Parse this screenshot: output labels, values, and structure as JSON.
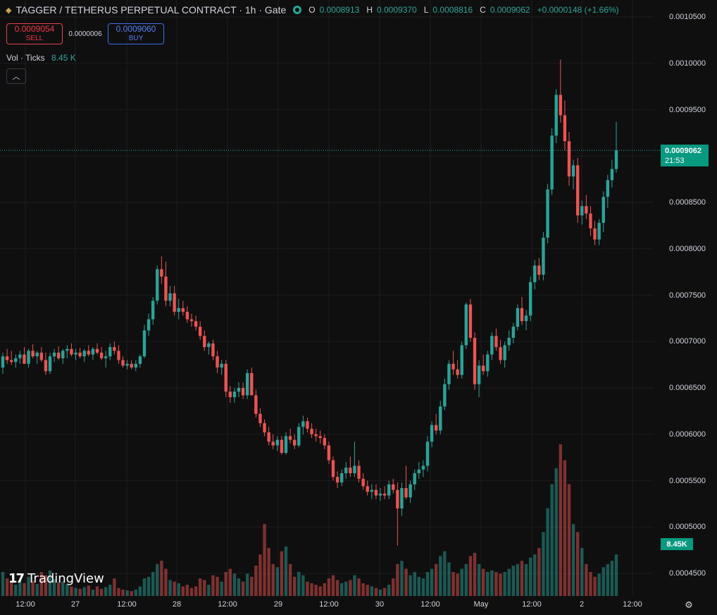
{
  "header": {
    "symbol_icon": "diamond-icon",
    "title": "TAGGER / TETHERUS PERPETUAL CONTRACT · 1h · Gate",
    "ohlc": {
      "o_label": "O",
      "o": "0.0008913",
      "h_label": "H",
      "h": "0.0009370",
      "l_label": "L",
      "l": "0.0008816",
      "c_label": "C",
      "c": "0.0009062",
      "change": "+0.0000148 (+1.66%)"
    }
  },
  "trade": {
    "sell_price": "0.0009054",
    "sell_label": "SELL",
    "spread": "0.0000006",
    "buy_price": "0.0009060",
    "buy_label": "BUY"
  },
  "volume_indicator": {
    "label": "Vol · Ticks",
    "value": "8.45 K"
  },
  "price_tag": {
    "price": "0.0009062",
    "countdown": "21:53"
  },
  "volume_tag": "8.45K",
  "logo_text": "TradingView",
  "colors": {
    "up": "#26a69a",
    "down": "#ef5350",
    "background": "#0f0f0f"
  },
  "chart_data": {
    "type": "candlestick",
    "symbol": "TAGGER / TETHERUS PERPETUAL CONTRACT",
    "interval": "1h",
    "exchange": "Gate",
    "y_ticks": [
      "0.0010500",
      "0.0010000",
      "0.0009500",
      "0.0009000",
      "0.0008500",
      "0.0008000",
      "0.0007500",
      "0.0007000",
      "0.0006500",
      "0.0006000",
      "0.0005500",
      "0.0005000",
      "0.0004500"
    ],
    "ylim": [
      0.00043,
      0.00107
    ],
    "x_ticks": [
      "12:00",
      "27",
      "12:00",
      "28",
      "12:00",
      "29",
      "12:00",
      "30",
      "12:00",
      "May",
      "12:00",
      "2",
      "12:00"
    ],
    "last_price": 0.0009062,
    "candles": [
      [
        0.000672,
        0.000688,
        0.000665,
        0.000684,
        30
      ],
      [
        0.000684,
        0.000692,
        0.000676,
        0.00068,
        22
      ],
      [
        0.00068,
        0.00069,
        0.000675,
        0.000678,
        18
      ],
      [
        0.000678,
        0.000686,
        0.000672,
        0.000682,
        14
      ],
      [
        0.000682,
        0.00069,
        0.000676,
        0.000686,
        20
      ],
      [
        0.000686,
        0.000694,
        0.00068,
        0.000676,
        16
      ],
      [
        0.000676,
        0.000692,
        0.000672,
        0.00069,
        24
      ],
      [
        0.00069,
        0.000697,
        0.000682,
        0.000684,
        19
      ],
      [
        0.000684,
        0.00069,
        0.000676,
        0.000688,
        15
      ],
      [
        0.000688,
        0.000694,
        0.000678,
        0.00068,
        30
      ],
      [
        0.00068,
        0.000688,
        0.000664,
        0.000668,
        26
      ],
      [
        0.000668,
        0.000688,
        0.000665,
        0.000684,
        32
      ],
      [
        0.000684,
        0.000692,
        0.000678,
        0.000688,
        21
      ],
      [
        0.000688,
        0.000695,
        0.00068,
        0.000682,
        17
      ],
      [
        0.000682,
        0.000692,
        0.000676,
        0.00069,
        18
      ],
      [
        0.00069,
        0.000696,
        0.000682,
        0.000692,
        15
      ],
      [
        0.000692,
        0.000698,
        0.000684,
        0.000686,
        12
      ],
      [
        0.000686,
        0.000692,
        0.00068,
        0.000688,
        10
      ],
      [
        0.000688,
        0.000693,
        0.000682,
        0.000684,
        9
      ],
      [
        0.000684,
        0.000692,
        0.000678,
        0.00069,
        11
      ],
      [
        0.00069,
        0.000696,
        0.000684,
        0.000686,
        13
      ],
      [
        0.000686,
        0.000694,
        0.00068,
        0.000692,
        8
      ],
      [
        0.000692,
        0.000698,
        0.000686,
        0.000688,
        12
      ],
      [
        0.000688,
        0.000694,
        0.00068,
        0.000682,
        9
      ],
      [
        0.000682,
        0.00069,
        0.000672,
        0.000684,
        11
      ],
      [
        0.000684,
        0.000698,
        0.00068,
        0.000694,
        14
      ],
      [
        0.000694,
        0.0007,
        0.000686,
        0.00069,
        22
      ],
      [
        0.00069,
        0.000696,
        0.000676,
        0.00068,
        10
      ],
      [
        0.00068,
        0.000684,
        0.000672,
        0.000674,
        8
      ],
      [
        0.000674,
        0.00068,
        0.00067,
        0.000676,
        7
      ],
      [
        0.000676,
        0.00068,
        0.00067,
        0.000672,
        6
      ],
      [
        0.000672,
        0.00068,
        0.000668,
        0.000676,
        8
      ],
      [
        0.000676,
        0.000686,
        0.000672,
        0.000684,
        12
      ],
      [
        0.000684,
        0.000718,
        0.000682,
        0.000712,
        22
      ],
      [
        0.000712,
        0.00073,
        0.000706,
        0.000724,
        24
      ],
      [
        0.000724,
        0.000748,
        0.000718,
        0.000744,
        30
      ],
      [
        0.000744,
        0.000782,
        0.00074,
        0.000778,
        40
      ],
      [
        0.000778,
        0.000792,
        0.000762,
        0.00077,
        44
      ],
      [
        0.00077,
        0.000786,
        0.000738,
        0.000744,
        34
      ],
      [
        0.000744,
        0.00076,
        0.000738,
        0.000752,
        20
      ],
      [
        0.000752,
        0.00076,
        0.000728,
        0.000732,
        18
      ],
      [
        0.000732,
        0.000746,
        0.000724,
        0.000736,
        16
      ],
      [
        0.000736,
        0.000744,
        0.000728,
        0.000732,
        12
      ],
      [
        0.000732,
        0.000738,
        0.00072,
        0.000724,
        14
      ],
      [
        0.000724,
        0.00073,
        0.000716,
        0.000722,
        10
      ],
      [
        0.000722,
        0.000728,
        0.000712,
        0.000716,
        12
      ],
      [
        0.000716,
        0.000722,
        0.000702,
        0.000706,
        22
      ],
      [
        0.000706,
        0.000712,
        0.00069,
        0.000694,
        20
      ],
      [
        0.000694,
        0.0007,
        0.000686,
        0.000698,
        14
      ],
      [
        0.000698,
        0.000702,
        0.00068,
        0.000684,
        26
      ],
      [
        0.000684,
        0.00069,
        0.000666,
        0.000672,
        24
      ],
      [
        0.000672,
        0.00068,
        0.000664,
        0.000676,
        18
      ],
      [
        0.000676,
        0.00068,
        0.00064,
        0.000646,
        30
      ],
      [
        0.000646,
        0.000652,
        0.000634,
        0.00064,
        34
      ],
      [
        0.00064,
        0.00065,
        0.000634,
        0.000646,
        28
      ],
      [
        0.000646,
        0.000656,
        0.00064,
        0.00065,
        22
      ],
      [
        0.00065,
        0.000656,
        0.000638,
        0.000642,
        18
      ],
      [
        0.000642,
        0.00067,
        0.000638,
        0.000666,
        28
      ],
      [
        0.000666,
        0.000672,
        0.00065,
        0.000642,
        24
      ],
      [
        0.000642,
        0.000648,
        0.000618,
        0.000622,
        38
      ],
      [
        0.000622,
        0.000628,
        0.000608,
        0.000612,
        52
      ],
      [
        0.000612,
        0.000616,
        0.000598,
        0.000602,
        90
      ],
      [
        0.000602,
        0.000608,
        0.000588,
        0.000592,
        60
      ],
      [
        0.000592,
        0.0006,
        0.000584,
        0.000588,
        40
      ],
      [
        0.000588,
        0.000598,
        0.000582,
        0.000594,
        36
      ],
      [
        0.000594,
        0.000598,
        0.000578,
        0.00058,
        56
      ],
      [
        0.00058,
        0.000602,
        0.000578,
        0.000598,
        62
      ],
      [
        0.000598,
        0.000606,
        0.00059,
        0.000594,
        40
      ],
      [
        0.000594,
        0.0006,
        0.000584,
        0.000588,
        24
      ],
      [
        0.000588,
        0.000612,
        0.000586,
        0.000608,
        30
      ],
      [
        0.000608,
        0.00062,
        0.0006,
        0.000614,
        26
      ],
      [
        0.000614,
        0.000618,
        0.000602,
        0.000606,
        18
      ],
      [
        0.000606,
        0.000612,
        0.000596,
        0.0006,
        16
      ],
      [
        0.0006,
        0.000606,
        0.000592,
        0.000598,
        14
      ],
      [
        0.000598,
        0.000604,
        0.00059,
        0.000596,
        12
      ],
      [
        0.000596,
        0.0006,
        0.000584,
        0.000588,
        16
      ],
      [
        0.000588,
        0.000592,
        0.000568,
        0.000572,
        22
      ],
      [
        0.000572,
        0.000576,
        0.00055,
        0.000554,
        26
      ],
      [
        0.000554,
        0.00056,
        0.000542,
        0.000548,
        20
      ],
      [
        0.000548,
        0.000562,
        0.000544,
        0.000558,
        16
      ],
      [
        0.000558,
        0.00057,
        0.000552,
        0.000564,
        18
      ],
      [
        0.000564,
        0.000576,
        0.000554,
        0.000558,
        20
      ],
      [
        0.000558,
        0.000592,
        0.000554,
        0.000566,
        26
      ],
      [
        0.000566,
        0.000572,
        0.000548,
        0.000552,
        22
      ],
      [
        0.000552,
        0.000558,
        0.00054,
        0.000544,
        16
      ],
      [
        0.000544,
        0.00055,
        0.000534,
        0.000538,
        14
      ],
      [
        0.000538,
        0.000546,
        0.00053,
        0.00054,
        12
      ],
      [
        0.00054,
        0.000546,
        0.00053,
        0.000534,
        10
      ],
      [
        0.000534,
        0.000542,
        0.000528,
        0.000536,
        8
      ],
      [
        0.000536,
        0.000544,
        0.00053,
        0.000534,
        10
      ],
      [
        0.000534,
        0.00055,
        0.00053,
        0.000546,
        14
      ],
      [
        0.000546,
        0.000552,
        0.000536,
        0.00054,
        22
      ],
      [
        0.00054,
        0.000548,
        0.00048,
        0.00052,
        40
      ],
      [
        0.00052,
        0.000548,
        0.000512,
        0.000542,
        44
      ],
      [
        0.000542,
        0.000566,
        0.00053,
        0.000532,
        34
      ],
      [
        0.000532,
        0.00055,
        0.000526,
        0.000546,
        26
      ],
      [
        0.000546,
        0.000562,
        0.00054,
        0.000558,
        30
      ],
      [
        0.000558,
        0.00057,
        0.000552,
        0.000562,
        24
      ],
      [
        0.000562,
        0.000572,
        0.000554,
        0.000566,
        22
      ],
      [
        0.000566,
        0.000598,
        0.00056,
        0.000592,
        30
      ],
      [
        0.000592,
        0.000614,
        0.000586,
        0.00061,
        34
      ],
      [
        0.00061,
        0.000622,
        0.0006,
        0.000604,
        40
      ],
      [
        0.000604,
        0.000636,
        0.0006,
        0.00063,
        50
      ],
      [
        0.00063,
        0.00066,
        0.000626,
        0.000654,
        56
      ],
      [
        0.000654,
        0.00068,
        0.000648,
        0.000676,
        42
      ],
      [
        0.000676,
        0.00069,
        0.000664,
        0.00067,
        30
      ],
      [
        0.00067,
        0.00068,
        0.00066,
        0.000664,
        28
      ],
      [
        0.000664,
        0.0007,
        0.00066,
        0.000696,
        34
      ],
      [
        0.000696,
        0.000742,
        0.000692,
        0.00074,
        40
      ],
      [
        0.00074,
        0.000746,
        0.0007,
        0.000704,
        50
      ],
      [
        0.000704,
        0.00071,
        0.000648,
        0.000654,
        54
      ],
      [
        0.000654,
        0.00068,
        0.00064,
        0.000674,
        40
      ],
      [
        0.000674,
        0.000686,
        0.000664,
        0.000668,
        34
      ],
      [
        0.000668,
        0.00069,
        0.000662,
        0.000686,
        30
      ],
      [
        0.000686,
        0.00071,
        0.00068,
        0.000706,
        32
      ],
      [
        0.000706,
        0.000714,
        0.00069,
        0.000694,
        30
      ],
      [
        0.000694,
        0.000702,
        0.000676,
        0.00068,
        28
      ],
      [
        0.00068,
        0.0007,
        0.000672,
        0.000696,
        30
      ],
      [
        0.000696,
        0.000712,
        0.00069,
        0.000704,
        34
      ],
      [
        0.000704,
        0.00072,
        0.000698,
        0.000716,
        38
      ],
      [
        0.000716,
        0.00074,
        0.000712,
        0.000736,
        40
      ],
      [
        0.000736,
        0.000748,
        0.000718,
        0.000722,
        44
      ],
      [
        0.000722,
        0.000734,
        0.000712,
        0.000728,
        40
      ],
      [
        0.000728,
        0.00077,
        0.000722,
        0.000764,
        48
      ],
      [
        0.000764,
        0.000788,
        0.000756,
        0.000782,
        52
      ],
      [
        0.000782,
        0.00079,
        0.000766,
        0.000772,
        60
      ],
      [
        0.000772,
        0.000818,
        0.000766,
        0.000812,
        80
      ],
      [
        0.000812,
        0.00087,
        0.000806,
        0.000864,
        110
      ],
      [
        0.000864,
        0.00093,
        0.000858,
        0.000922,
        140
      ],
      [
        0.000922,
        0.000972,
        0.000914,
        0.000966,
        160
      ],
      [
        0.000966,
        0.001004,
        0.000936,
        0.000944,
        190
      ],
      [
        0.000944,
        0.00096,
        0.000906,
        0.000916,
        170
      ],
      [
        0.000916,
        0.000926,
        0.000868,
        0.000878,
        140
      ],
      [
        0.000878,
        0.000896,
        0.000864,
        0.00089,
        90
      ],
      [
        0.00089,
        0.000898,
        0.000828,
        0.000836,
        80
      ],
      [
        0.000836,
        0.000852,
        0.000826,
        0.000846,
        60
      ],
      [
        0.000846,
        0.000858,
        0.000832,
        0.000838,
        40
      ],
      [
        0.000838,
        0.000846,
        0.000814,
        0.000822,
        30
      ],
      [
        0.000822,
        0.00083,
        0.000804,
        0.00081,
        24
      ],
      [
        0.00081,
        0.000832,
        0.000804,
        0.000828,
        28
      ],
      [
        0.000828,
        0.000862,
        0.000818,
        0.000856,
        36
      ],
      [
        0.000856,
        0.00088,
        0.000844,
        0.000874,
        40
      ],
      [
        0.000874,
        0.000896,
        0.000866,
        0.000886,
        44
      ],
      [
        0.000886,
        0.000937,
        0.000882,
        0.000906,
        52
      ]
    ]
  }
}
